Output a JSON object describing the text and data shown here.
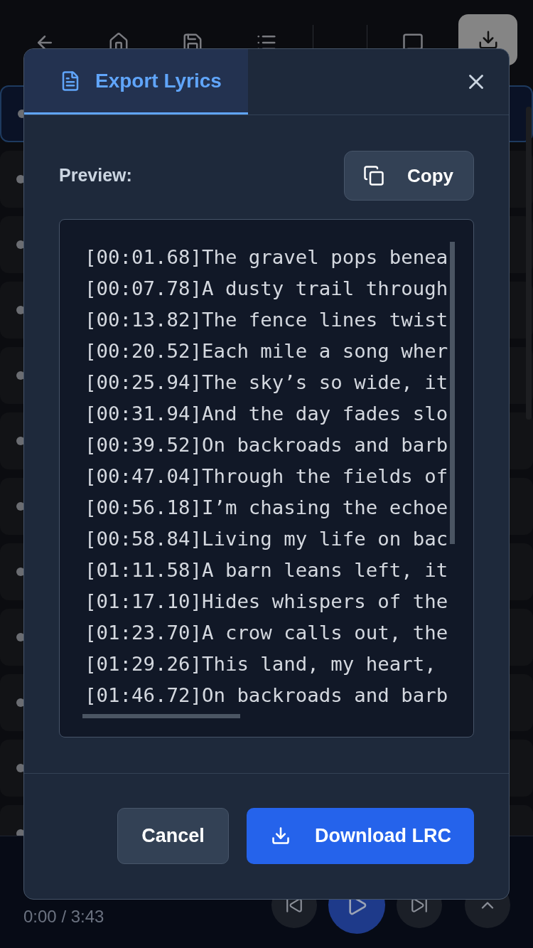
{
  "toolbar": [
    {
      "selected": false
    },
    {
      "selected": false
    },
    {
      "selected": false
    },
    {
      "selected": false
    },
    {
      "selected": false
    },
    {
      "selected": true
    }
  ],
  "rows": [
    {
      "selected": true
    },
    {
      "selected": false
    },
    {
      "selected": false
    },
    {
      "selected": false
    },
    {
      "selected": false
    },
    {
      "selected": false
    },
    {
      "selected": false
    },
    {
      "selected": false
    },
    {
      "selected": false
    },
    {
      "selected": false
    },
    {
      "selected": false
    },
    {
      "selected": false
    }
  ],
  "dialog": {
    "tabs": [
      {
        "label": "Export Lyrics",
        "selected": true
      }
    ],
    "preview_label": "Preview:",
    "copy_button": "Copy",
    "preview_lines": [
      "[00:01.68]The gravel pops benea",
      "[00:07.78]A dusty trail through",
      "[00:13.82]The fence lines twist",
      "[00:20.52]Each mile a song wher",
      "[00:25.94]The sky’s so wide, it",
      "[00:31.94]And the day fades slo",
      "[00:39.52]On backroads and barb",
      "[00:47.04]Through the fields of",
      "[00:56.18]I’m chasing the echoe",
      "[00:58.84]Living my life on bac",
      "[01:11.58]A barn leans left, it",
      "[01:17.10]Hides whispers of the",
      "[01:23.70]A crow calls out, the",
      "[01:29.26]This land, my heart,",
      "[01:46.72]On backroads and barb"
    ],
    "buttons": [
      {
        "kind": "secondary",
        "label": "Cancel"
      },
      {
        "kind": "primary",
        "label": "Download LRC"
      }
    ]
  },
  "player": {
    "time": "0:00 / 3:43",
    "playing": false
  }
}
